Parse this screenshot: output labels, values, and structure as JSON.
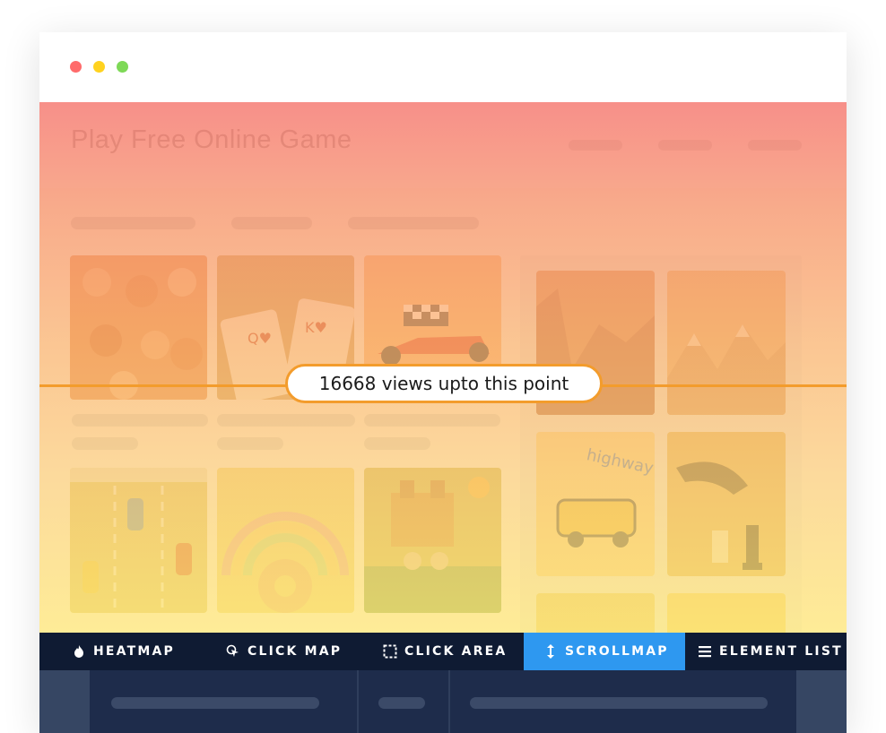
{
  "window": {
    "controls": [
      "close",
      "minimize",
      "maximize"
    ]
  },
  "site": {
    "title": "Play Free Online Game"
  },
  "scrollmap": {
    "label": "16668 views upto this point",
    "views": 16668
  },
  "toolbar": {
    "items": [
      {
        "label": "HEATMAP",
        "icon": "flame-icon",
        "active": false
      },
      {
        "label": "CLICK MAP",
        "icon": "cursor-click-icon",
        "active": false
      },
      {
        "label": "CLICK AREA",
        "icon": "dashed-square-icon",
        "active": false
      },
      {
        "label": "SCROLLMAP",
        "icon": "vertical-arrows-icon",
        "active": true
      },
      {
        "label": "ELEMENT LIST",
        "icon": "list-icon",
        "active": false
      }
    ]
  },
  "colors": {
    "toolbar_bg": "#0f1b33",
    "active_tab": "#2e98f0",
    "scroll_line": "#f39c2c",
    "heat_top": "#f67870",
    "heat_bottom": "#ffe878"
  }
}
